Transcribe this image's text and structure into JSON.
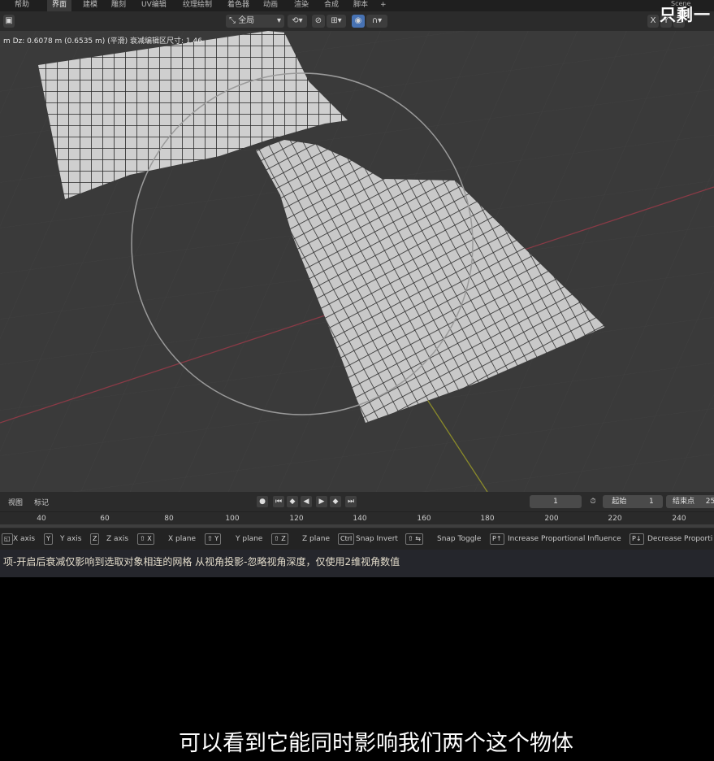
{
  "workspace_tabs": [
    "帮助",
    "界面",
    "建模",
    "雕刻",
    "UV编辑",
    "纹理绘制",
    "着色器",
    "动画",
    "渲染",
    "合成",
    "脚本",
    "+"
  ],
  "active_tab": "界面",
  "header": {
    "orientation": "全局",
    "axis_x": "X",
    "axis_y": "Y",
    "axis_z": "Z"
  },
  "scene_label": "Scene",
  "overlay_corner_text": "只剩一",
  "viewport": {
    "transform_readout": "m  Dz: 0.6078 m (0.6535 m) (平滑)   衰减编辑区尺寸: 1.46"
  },
  "timeline": {
    "menu_view": "视图",
    "menu_marker": "标记",
    "current_frame": "1",
    "start_label": "起始",
    "start_value": "1",
    "end_label": "结束点",
    "end_value": "25",
    "ruler_ticks": [
      "40",
      "60",
      "80",
      "100",
      "120",
      "140",
      "160",
      "180",
      "200",
      "220",
      "240"
    ]
  },
  "keymap": {
    "items": [
      {
        "key": "X",
        "label": "X axis"
      },
      {
        "key": "Y",
        "label": "Y axis"
      },
      {
        "key": "Z",
        "label": "Z axis"
      },
      {
        "key": "⇧ X",
        "label": "X plane"
      },
      {
        "key": "⇧ Y",
        "label": "Y plane"
      },
      {
        "key": "⇧ Z",
        "label": "Z plane"
      },
      {
        "key": "Ctrl",
        "label": "Snap Invert"
      },
      {
        "key": "⇧ ⇆",
        "label": "Snap Toggle"
      },
      {
        "key": "P↑",
        "label": "Increase Proportional Influence"
      },
      {
        "key": "P↓",
        "label": "Decrease Proporti"
      }
    ]
  },
  "hint_text": "项-开启后衰减仅影响到选取对象相连的网格  从视角投影-忽略视角深度，仅使用2维视角数值",
  "subtitle": "可以看到它能同时影响我们两个这个物体"
}
